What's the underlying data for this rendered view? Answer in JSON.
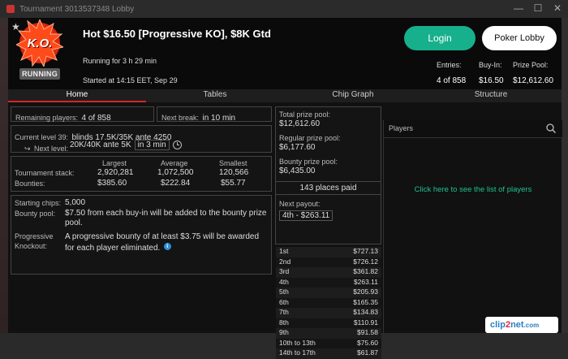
{
  "titlebar": {
    "text": "Tournament 3013537348 Lobby",
    "minimize": "—",
    "maximize": "☐",
    "close": "✕"
  },
  "header": {
    "star": "★",
    "badge_text": "K.O.",
    "running_badge": "RUNNING",
    "title": "Hot $16.50 [Progressive KO], $8K Gtd",
    "running_for": "Running for 3 h 29 min",
    "started": "Started at 14:15 EET, Sep 29",
    "login_label": "Login",
    "lobby_label": "Poker Lobby",
    "entries_label": "Entries:",
    "entries_value": "4 of 858",
    "buyin_label": "Buy-In:",
    "buyin_value": "$16.50",
    "prizepool_label": "Prize Pool:",
    "prizepool_value": "$12,612.60"
  },
  "tabs": [
    {
      "label": "Home",
      "active": true
    },
    {
      "label": "Tables",
      "active": false
    },
    {
      "label": "Chip Graph",
      "active": false
    },
    {
      "label": "Structure",
      "active": false
    }
  ],
  "home": {
    "remaining_label": "Remaining players:",
    "remaining_value": "4 of 858",
    "next_break_label": "Next break:",
    "next_break_value": "in 10 min",
    "current_level_label": "Current level 39:",
    "current_level_value": "blinds 17.5K/35K ante 4250",
    "next_level_label": "Next level:",
    "next_level_value": "20K/40K ante 5K",
    "next_level_time": "in 3 min",
    "stack_headers": [
      "Largest",
      "Average",
      "Smallest"
    ],
    "stack_label": "Tournament stack:",
    "stack_values": [
      "2,920,281",
      "1,072,500",
      "120,566"
    ],
    "bounties_label": "Bounties:",
    "bounties_values": [
      "$385.60",
      "$222.84",
      "$55.77"
    ],
    "starting_chips_label": "Starting chips:",
    "starting_chips_value": "5,000",
    "bounty_pool_label": "Bounty pool:",
    "bounty_pool_value": "$7.50 from each buy-in will be added to the bounty prize pool.",
    "progressive_label": "Progressive Knockout:",
    "progressive_value": "A progressive bounty of at least $3.75 will be awarded for each player eliminated.",
    "info_glyph": "i"
  },
  "prizes": {
    "total_label": "Total prize pool:",
    "total_value": "$12,612.60",
    "regular_label": "Regular prize pool:",
    "regular_value": "$6,177.60",
    "bounty_label": "Bounty prize pool:",
    "bounty_value": "$6,435.00",
    "places_paid": "143 places paid",
    "next_payout_label": "Next payout:",
    "next_payout_value": "4th - $263.11",
    "payouts": [
      {
        "place": "1st",
        "amount": "$727.13"
      },
      {
        "place": "2nd",
        "amount": "$726.12"
      },
      {
        "place": "3rd",
        "amount": "$361.82"
      },
      {
        "place": "4th",
        "amount": "$263.11"
      },
      {
        "place": "5th",
        "amount": "$205.93"
      },
      {
        "place": "6th",
        "amount": "$165.35"
      },
      {
        "place": "7th",
        "amount": "$134.83"
      },
      {
        "place": "8th",
        "amount": "$110.91"
      },
      {
        "place": "9th",
        "amount": "$91.58"
      },
      {
        "place": "10th to 13th",
        "amount": "$75.60"
      },
      {
        "place": "14th to 17th",
        "amount": "$61.87"
      }
    ]
  },
  "players": {
    "header": "Players",
    "link_text": "Click here to see the list of players"
  },
  "watermark": {
    "part1": "clip",
    "part2": "2",
    "part3": "net",
    "part4": ".com"
  },
  "colors": {
    "accent_green": "#17b08c",
    "tab_red": "#d62626",
    "link_green": "#1fc191"
  }
}
